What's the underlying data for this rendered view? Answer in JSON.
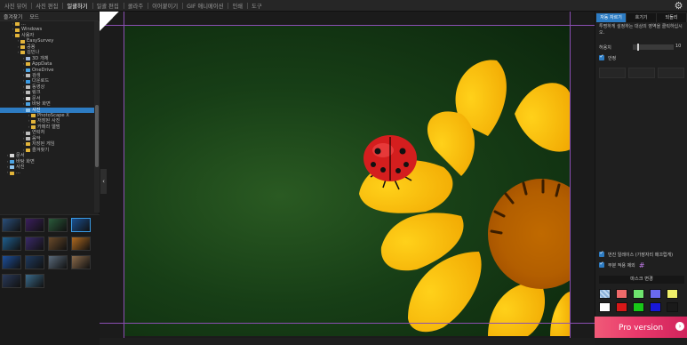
{
  "menubar": {
    "items": [
      "사진 뷰어",
      "사진 편집",
      "일괄하기",
      "일괄 편집",
      "콜라주",
      "이어붙이기",
      "GIF 애니메이션",
      "인쇄",
      "도구"
    ],
    "active_index": 2,
    "settings_icon": "gear-icon"
  },
  "left_panel": {
    "tabs": [
      "즐겨찾기",
      "모드"
    ],
    "tree": [
      {
        "label": "...",
        "depth": 2,
        "icon": "folder"
      },
      {
        "label": "Windows",
        "depth": 2,
        "icon": "folder"
      },
      {
        "label": "사용자",
        "depth": 2,
        "icon": "folder"
      },
      {
        "label": "EasySurvey",
        "depth": 3,
        "icon": "folder"
      },
      {
        "label": "공용",
        "depth": 3,
        "icon": "folder"
      },
      {
        "label": "김민나",
        "depth": 3,
        "icon": "folder"
      },
      {
        "label": "3D 개체",
        "depth": 4,
        "icon": "cube"
      },
      {
        "label": "AppData",
        "depth": 4,
        "icon": "folder"
      },
      {
        "label": "OneDrive",
        "depth": 4,
        "icon": "cloud"
      },
      {
        "label": "검색",
        "depth": 4,
        "icon": "search"
      },
      {
        "label": "다운로드",
        "depth": 4,
        "icon": "download"
      },
      {
        "label": "동영상",
        "depth": 4,
        "icon": "video"
      },
      {
        "label": "링크",
        "depth": 4,
        "icon": "link"
      },
      {
        "label": "문서",
        "depth": 4,
        "icon": "doc"
      },
      {
        "label": "바탕 화면",
        "depth": 4,
        "icon": "desktop"
      },
      {
        "label": "사진",
        "depth": 4,
        "icon": "picture",
        "selected": true
      },
      {
        "label": "PhotoScape X",
        "depth": 5,
        "icon": "folder"
      },
      {
        "label": "저장된 사진",
        "depth": 5,
        "icon": "folder"
      },
      {
        "label": "카메라 앨범",
        "depth": 5,
        "icon": "folder"
      },
      {
        "label": "연락처",
        "depth": 4,
        "icon": "contact"
      },
      {
        "label": "음악",
        "depth": 4,
        "icon": "music"
      },
      {
        "label": "저장된 게임",
        "depth": 4,
        "icon": "folder"
      },
      {
        "label": "즐겨찾기",
        "depth": 4,
        "icon": "star"
      },
      {
        "label": "문서",
        "depth": 1,
        "icon": "doc"
      },
      {
        "label": "바탕 화면",
        "depth": 1,
        "icon": "desktop"
      },
      {
        "label": "사진",
        "depth": 1,
        "icon": "picture"
      },
      {
        "label": "...",
        "depth": 1,
        "icon": "folder"
      }
    ],
    "thumbnails": 14
  },
  "right_panel": {
    "tabs": [
      "자동 자르기",
      "흐기기",
      "되돌리"
    ],
    "description": "투명하게 설정하는 대상의 영역을 클릭하십시오.",
    "tolerance_label": "허용치",
    "tolerance_value": "10",
    "tolerance_fraction": 0.1,
    "smooth_label": "안정",
    "defringe_label": "번진 일레이스 (가장자리 매끄럽게)",
    "mask_toggle_label": "부분 적용 제외",
    "mask_section_label": "마스크 변경",
    "promo_text": "Pro version"
  },
  "colors": {
    "accent": "#2d7cc3",
    "guide": "#8b4fb3",
    "swatches": [
      "#c0d8f0",
      "#ef6a6a",
      "#6ee36e",
      "#6a6aef",
      "#efef6a",
      "#ffffff",
      "#d81818",
      "#18c818",
      "#1818d8",
      "#1a1a1a"
    ]
  }
}
